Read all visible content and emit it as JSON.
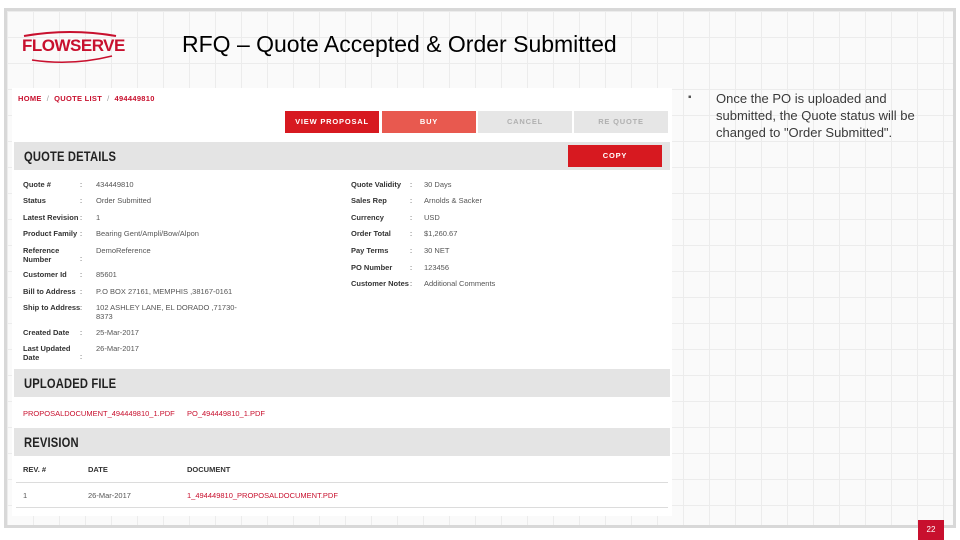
{
  "slide": {
    "title": "RFQ – Quote Accepted & Order Submitted",
    "logo_text": "FLOWSERVE",
    "bullet_symbol": "▪",
    "note": "Once the PO is uploaded and submitted, the Quote status will be changed to \"Order Submitted\".",
    "page_number": "22"
  },
  "breadcrumb": {
    "items": [
      "HOME",
      "QUOTE LIST",
      "494449810"
    ],
    "separator": "/"
  },
  "actions": {
    "view_proposal": "VIEW PROPOSAL",
    "buy": "BUY",
    "cancel": "CANCEL",
    "requote": "RE QUOTE"
  },
  "quote_details": {
    "title": "QUOTE DETAILS",
    "copy": "COPY",
    "colon": ":",
    "left": [
      {
        "label": "Quote #",
        "value": "434449810"
      },
      {
        "label": "Status",
        "value": "Order Submitted"
      },
      {
        "label": "Latest Revision",
        "value": "1"
      },
      {
        "label": "Product Family",
        "value": "Bearing Gent/Ampli/Bow/Alpon"
      },
      {
        "label": "Reference Number",
        "value": "DemoReference"
      },
      {
        "label": "Customer Id",
        "value": "85601"
      },
      {
        "label": "Bill to Address",
        "value": "P.O BOX 27161, MEMPHIS ,38167-0161"
      },
      {
        "label": "Ship to Address",
        "value": "102 ASHLEY LANE, EL DORADO ,71730-8373"
      },
      {
        "label": "Created Date",
        "value": "25-Mar-2017"
      },
      {
        "label": "Last Updated Date",
        "value": "26-Mar-2017"
      }
    ],
    "right": [
      {
        "label": "Quote Validity",
        "value": "30 Days"
      },
      {
        "label": "Sales Rep",
        "value": "Arnolds & Sacker"
      },
      {
        "label": "Currency",
        "value": "USD"
      },
      {
        "label": "Order Total",
        "value": "$1,260.67"
      },
      {
        "label": "Pay Terms",
        "value": "30 NET"
      },
      {
        "label": "PO Number",
        "value": "123456"
      },
      {
        "label": "Customer Notes",
        "value": "Additional Comments"
      }
    ]
  },
  "uploaded_file": {
    "title": "UPLOADED FILE",
    "files": [
      "PROPOSALDOCUMENT_494449810_1.PDF",
      "PO_494449810_1.PDF"
    ]
  },
  "revision": {
    "title": "REVISION",
    "headers": [
      "REV. #",
      "DATE",
      "DOCUMENT"
    ],
    "rows": [
      {
        "rev": "1",
        "date": "26-Mar-2017",
        "document": "1_494449810_PROPOSALDOCUMENT.PDF"
      }
    ]
  },
  "colors": {
    "brand_red": "#c8102e",
    "button_red": "#d71920",
    "button_light_red": "#e8594f",
    "button_grey": "#e6e6e6",
    "section_grey": "#e4e4e4"
  }
}
